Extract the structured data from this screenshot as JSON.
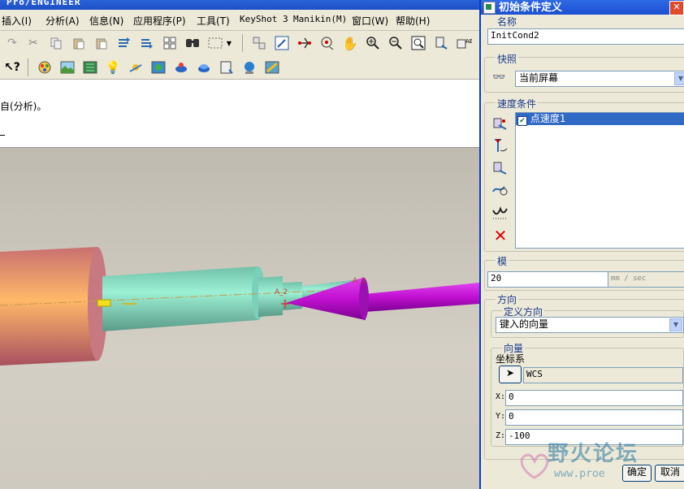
{
  "app": {
    "title": "Pro/ENGINEER"
  },
  "menu": [
    {
      "label": "插入(I)"
    },
    {
      "label": "分析(A)"
    },
    {
      "label": "信息(N)"
    },
    {
      "label": "应用程序(P)"
    },
    {
      "label": "工具(T)"
    },
    {
      "label": "KeyShot 3"
    },
    {
      "label": "Manikin(M)"
    },
    {
      "label": "窗口(W)"
    },
    {
      "label": "帮助(H)"
    }
  ],
  "message": {
    "text": "自(分析)。"
  },
  "model_labels": {
    "a2": "A_2",
    "a3": "A_3"
  },
  "dialog": {
    "title": "初始条件定义",
    "name_label": "名称",
    "name_value": "InitCond2",
    "snapshot_label": "快照",
    "snapshot_value": "当前屏幕",
    "velocity_label": "速度条件",
    "velocity_items": [
      {
        "label": "点速度1",
        "checked": true
      }
    ],
    "magnitude_label": "模",
    "magnitude_value": "20",
    "magnitude_unit": "mm / sec",
    "direction_label": "方向",
    "define_direction_label": "定义方向",
    "define_direction_value": "键入的向量",
    "vector_label": "向量",
    "coord_label": "坐标系",
    "coord_value": "WCS",
    "x_label": "X:",
    "x_value": "0",
    "y_label": "Y:",
    "y_value": "0",
    "z_label": "Z:",
    "z_value": "-100",
    "ok_label": "确定",
    "cancel_label": "取消"
  },
  "watermark": {
    "text": "野火论坛",
    "url_text": "www.proe"
  }
}
